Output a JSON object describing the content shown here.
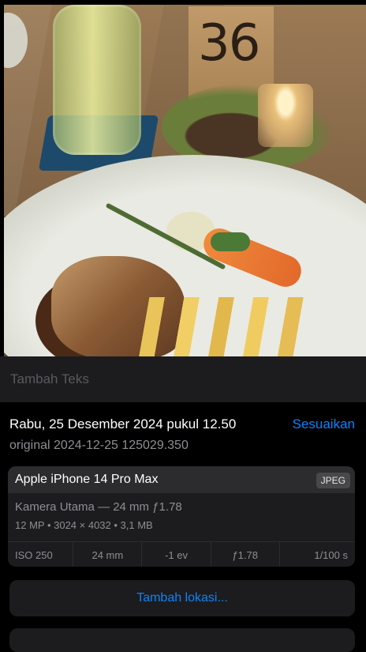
{
  "photo": {
    "table_number": "36"
  },
  "caption": {
    "placeholder": "Tambah Teks"
  },
  "info": {
    "date": "Rabu, 25 Desember 2024 pukul 12.50",
    "adjust_label": "Sesuaikan",
    "filename": "original 2024-12-25 125029.350"
  },
  "camera": {
    "device": "Apple iPhone 14 Pro Max",
    "format": "JPEG",
    "lens": "Kamera Utama — 24 mm ƒ1.78",
    "specs": "12 MP • 3024 × 4032 • 3,1 MB",
    "exif": {
      "iso": "ISO 250",
      "focal": "24 mm",
      "ev": "-1 ev",
      "aperture": "ƒ1.78",
      "shutter": "1/100 s"
    }
  },
  "location": {
    "add_label": "Tambah lokasi..."
  }
}
